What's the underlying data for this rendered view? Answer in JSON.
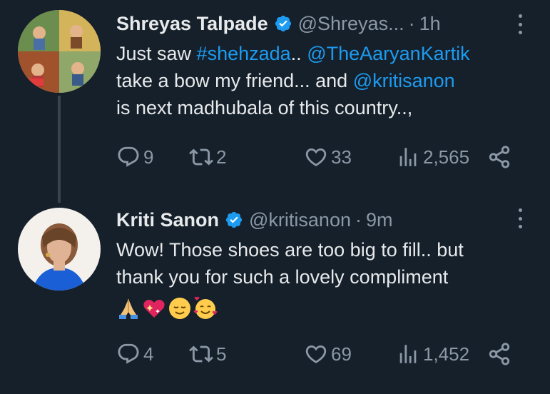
{
  "tweets": [
    {
      "author": {
        "name": "Shreyas Talpade",
        "handle": "@Shreyas...",
        "avatar": "movie-poster-avatar"
      },
      "time": "1h",
      "separator": "·",
      "text": {
        "line1_pre": "Just saw ",
        "hashtag": "#shehzada",
        "line1_mid": ".. ",
        "mention1": "@TheAaryanKartik",
        "line2_pre": "take a bow my friend... and ",
        "mention2": "@kritisanon",
        "line3": "is next madhubala of this country..,"
      },
      "stats": {
        "replies": "9",
        "retweets": "2",
        "likes": "33",
        "views": "2,565"
      }
    },
    {
      "author": {
        "name": "Kriti Sanon",
        "handle": "@kritisanon",
        "avatar": "profile-photo-avatar"
      },
      "time": "9m",
      "separator": "·",
      "text": {
        "line1": "Wow! Those shoes are too big to fill.. but",
        "line2": "thank you for such a lovely compliment",
        "emojis": [
          "folded-hands",
          "sparkling-heart",
          "relieved-face",
          "smiling-face-with-hearts"
        ]
      },
      "stats": {
        "replies": "4",
        "retweets": "5",
        "likes": "69",
        "views": "1,452"
      }
    }
  ],
  "colors": {
    "background": "#15202b",
    "text": "#e7e9ea",
    "muted": "#8b98a5",
    "link": "#1d9bf0",
    "verified": "#1d9bf0",
    "thread_line": "#38444d"
  },
  "icons": [
    "reply-icon",
    "retweet-icon",
    "like-icon",
    "views-icon",
    "share-icon",
    "verified-badge-icon",
    "more-options-icon"
  ]
}
